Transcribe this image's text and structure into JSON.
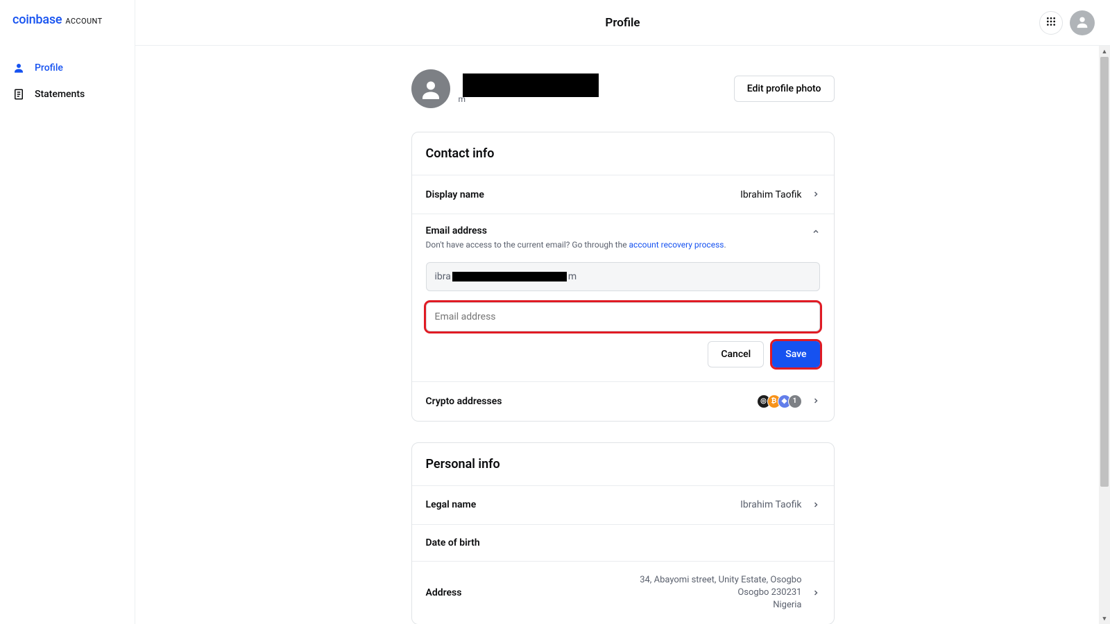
{
  "brand": {
    "name": "coinbase",
    "sub": "ACCOUNT"
  },
  "page_title": "Profile",
  "sidebar": {
    "items": [
      {
        "label": "Profile",
        "active": true
      },
      {
        "label": "Statements",
        "active": false
      }
    ]
  },
  "profile_header": {
    "email_suffix": "m",
    "edit_photo_label": "Edit profile photo"
  },
  "contact_card": {
    "title": "Contact info",
    "display_name_label": "Display name",
    "display_name_value": "Ibrahim Taofik",
    "email_label": "Email address",
    "email_help_prefix": "Don't have access to the current email? Go through the ",
    "email_help_link": "account recovery process",
    "email_help_suffix": ".",
    "current_email_prefix": "ibra",
    "current_email_suffix": "m",
    "new_email_placeholder": "Email address",
    "cancel_label": "Cancel",
    "save_label": "Save",
    "crypto_label": "Crypto addresses",
    "crypto_icons": [
      "generic",
      "bitcoin",
      "ethereum",
      "count"
    ],
    "crypto_count": "1"
  },
  "personal_card": {
    "title": "Personal info",
    "legal_name_label": "Legal name",
    "legal_name_value": "Ibrahim Taofik",
    "dob_label": "Date of birth",
    "address_label": "Address",
    "address_line1": "34, Abayomi street, Unity Estate, Osogbo",
    "address_line2": "Osogbo 230231",
    "address_line3": "Nigeria"
  }
}
